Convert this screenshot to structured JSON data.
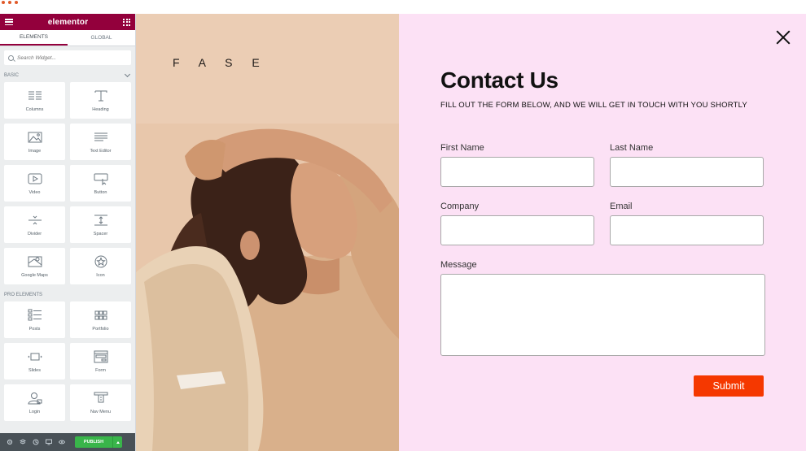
{
  "colors": {
    "brand": "#93003c",
    "publish": "#39b54a",
    "panel_bg": "#fce1f5",
    "submit_bg": "#f53800",
    "photo_bg": "#e6c3a6"
  },
  "sidebar": {
    "title": "elementor",
    "tabs": [
      {
        "label": "ELEMENTS"
      },
      {
        "label": "GLOBAL"
      }
    ],
    "search_placeholder": "Search Widget...",
    "basic_header": "BASIC",
    "pro_header": "PRO ELEMENTS",
    "basic_widgets": [
      {
        "label": "Columns",
        "icon": "columns-icon"
      },
      {
        "label": "Heading",
        "icon": "heading-icon"
      },
      {
        "label": "Image",
        "icon": "image-icon"
      },
      {
        "label": "Text Editor",
        "icon": "text-editor-icon"
      },
      {
        "label": "Video",
        "icon": "video-icon"
      },
      {
        "label": "Button",
        "icon": "button-icon"
      },
      {
        "label": "Divider",
        "icon": "divider-icon"
      },
      {
        "label": "Spacer",
        "icon": "spacer-icon"
      },
      {
        "label": "Google Maps",
        "icon": "map-icon"
      },
      {
        "label": "Icon",
        "icon": "star-icon"
      }
    ],
    "pro_widgets": [
      {
        "label": "Posts",
        "icon": "posts-icon"
      },
      {
        "label": "Portfolio",
        "icon": "portfolio-icon"
      },
      {
        "label": "Slides",
        "icon": "slides-icon"
      },
      {
        "label": "Form",
        "icon": "form-icon"
      },
      {
        "label": "Login",
        "icon": "login-icon"
      },
      {
        "label": "Nav Menu",
        "icon": "nav-menu-icon"
      }
    ],
    "bottom": {
      "publish_label": "PUBLISH"
    }
  },
  "preview": {
    "brand": "F A S E"
  },
  "form": {
    "title": "Contact Us",
    "subtitle": "FILL OUT THE FORM BELOW, AND WE WILL GET IN TOUCH WITH YOU SHORTLY",
    "first_name_label": "First Name",
    "last_name_label": "Last Name",
    "company_label": "Company",
    "email_label": "Email",
    "message_label": "Message",
    "submit_label": "Submit"
  }
}
